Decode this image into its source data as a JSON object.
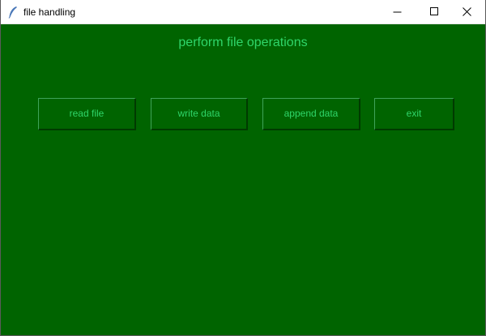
{
  "window": {
    "title": "file handling",
    "icon": "feather-icon",
    "controls": [
      "minimize-icon",
      "maximize-icon",
      "close-icon"
    ]
  },
  "main": {
    "heading": "perform file operations",
    "buttons": [
      {
        "label": "read file"
      },
      {
        "label": "write data"
      },
      {
        "label": "append data"
      },
      {
        "label": "exit"
      }
    ]
  },
  "colors": {
    "background": "#006400",
    "text": "#2fd66a",
    "titlebar": "#ffffff"
  }
}
